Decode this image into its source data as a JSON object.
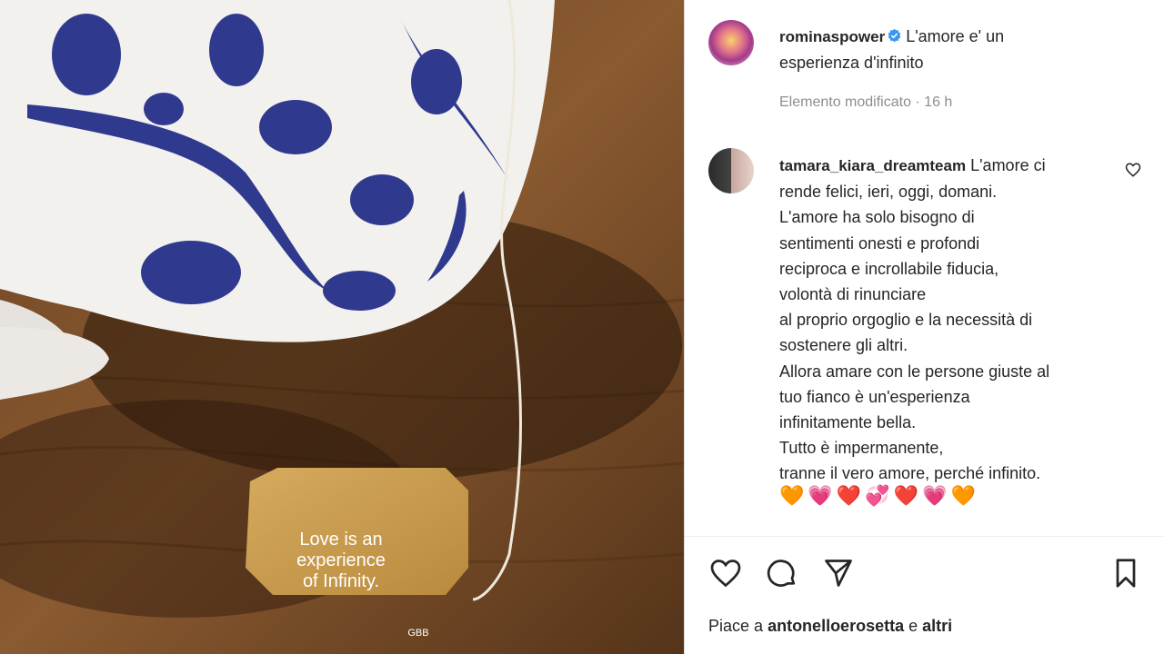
{
  "post": {
    "image": {
      "tag_text_line1": "Love is an",
      "tag_text_line2": "experience",
      "tag_text_line3": "of Infinity.",
      "tag_brand": "GBB"
    },
    "author": "rominaspower",
    "caption_line1": "L'amore e' un",
    "caption_line2": "esperienza d'infinito",
    "meta": "Elemento modificato · 16 h"
  },
  "comment": {
    "author": "tamara_kiara_dreamteam",
    "first": "L'amore ci",
    "lines": [
      "rende felici, ieri, oggi, domani.",
      "L'amore ha solo bisogno di",
      "sentimenti onesti e profondi",
      "reciproca e incrollabile fiducia,",
      "volontà di rinunciare",
      "al proprio orgoglio e la necessità di",
      "sostenere gli altri.",
      "Allora amare con le persone giuste al",
      "tuo fianco è un'esperienza",
      "infinitamente bella.",
      "Tutto è impermanente,",
      "tranne il vero amore, perché infinito."
    ],
    "emojis": [
      "🧡",
      "💗",
      "❤️",
      "💞",
      "❤️",
      "💗",
      "🧡"
    ]
  },
  "likes": {
    "prefix": "Piace a",
    "user": "antonelloerosetta",
    "connector": "e",
    "suffix": "altri"
  },
  "icons": {
    "like": "heart-icon",
    "comment": "comment-icon",
    "share": "paper-plane-icon",
    "save": "bookmark-icon",
    "verified": "verified-badge-icon"
  },
  "colors": {
    "verified": "#3897f0",
    "text": "#262626",
    "secondary": "#8e8e8e"
  }
}
